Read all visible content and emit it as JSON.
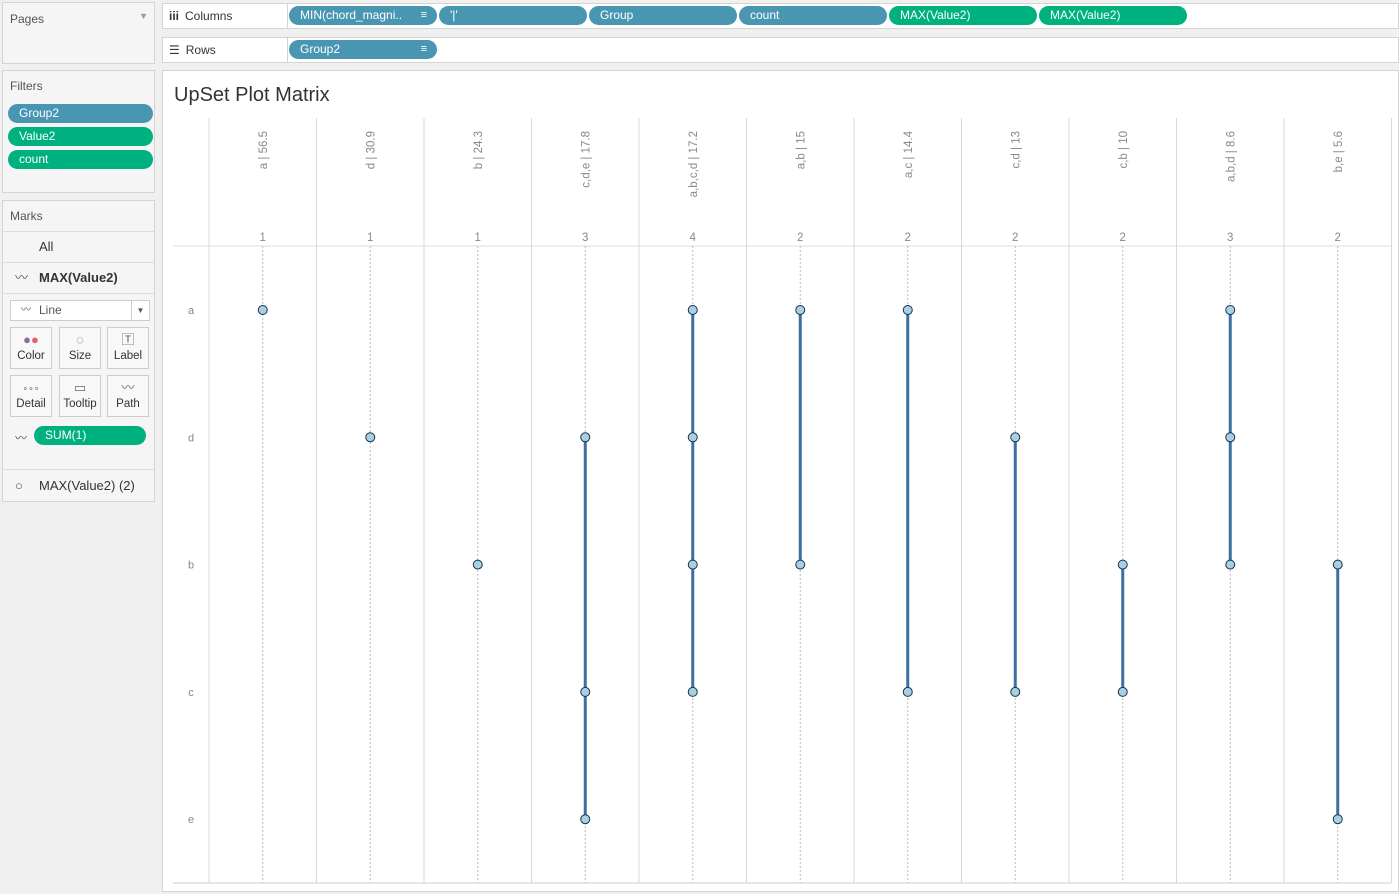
{
  "pages": {
    "title": "Pages"
  },
  "columns_shelf": {
    "label": "Columns",
    "pills": [
      {
        "text": "MIN(chord_magni..",
        "color": "#4996b2",
        "sort": true
      },
      {
        "text": "'|'",
        "color": "#4996b2",
        "sort": false
      },
      {
        "text": "Group",
        "color": "#4996b2",
        "sort": false
      },
      {
        "text": "count",
        "color": "#4996b2",
        "sort": false
      },
      {
        "text": "MAX(Value2)",
        "color": "#00b180",
        "sort": false
      },
      {
        "text": "MAX(Value2)",
        "color": "#00b180",
        "sort": false
      }
    ]
  },
  "rows_shelf": {
    "label": "Rows",
    "pills": [
      {
        "text": "Group2",
        "color": "#4996b2",
        "sort": true
      }
    ]
  },
  "filters": {
    "title": "Filters",
    "items": [
      {
        "text": "Group2",
        "color": "#4996b2"
      },
      {
        "text": "Value2",
        "color": "#00b180"
      },
      {
        "text": "count",
        "color": "#00b180"
      }
    ]
  },
  "marks": {
    "title": "Marks",
    "all": "All",
    "card1": "MAX(Value2)",
    "mark_type": "Line",
    "buttons": [
      "Color",
      "Size",
      "Label",
      "Detail",
      "Tooltip",
      "Path"
    ],
    "path_pill": "SUM(1)",
    "card2": "MAX(Value2) (2)"
  },
  "chart_data": {
    "type": "scatter",
    "title": "UpSet Plot Matrix",
    "row_labels": [
      "a",
      "d",
      "b",
      "c",
      "e"
    ],
    "columns": [
      {
        "set": "a",
        "value": "56.5",
        "count": "1",
        "members": [
          "a"
        ]
      },
      {
        "set": "d",
        "value": "30.9",
        "count": "1",
        "members": [
          "d"
        ]
      },
      {
        "set": "b",
        "value": "24.3",
        "count": "1",
        "members": [
          "b"
        ]
      },
      {
        "set": "c,d,e",
        "value": "17.8",
        "count": "3",
        "members": [
          "d",
          "c",
          "e"
        ]
      },
      {
        "set": "a,b,c,d",
        "value": "17.2",
        "count": "4",
        "members": [
          "a",
          "d",
          "b",
          "c"
        ]
      },
      {
        "set": "a,b",
        "value": "15",
        "count": "2",
        "members": [
          "a",
          "b"
        ]
      },
      {
        "set": "a,c",
        "value": "14.4",
        "count": "2",
        "members": [
          "a",
          "c"
        ]
      },
      {
        "set": "c,d",
        "value": "13",
        "count": "2",
        "members": [
          "d",
          "c"
        ]
      },
      {
        "set": "c,b",
        "value": "10",
        "count": "2",
        "members": [
          "b",
          "c"
        ]
      },
      {
        "set": "a,b,d",
        "value": "8.6",
        "count": "3",
        "members": [
          "a",
          "d",
          "b"
        ]
      },
      {
        "set": "b,e",
        "value": "5.6",
        "count": "2",
        "members": [
          "b",
          "e"
        ]
      }
    ],
    "line_color": "#3d6fa3",
    "dot_color": "#a6cfe8"
  }
}
